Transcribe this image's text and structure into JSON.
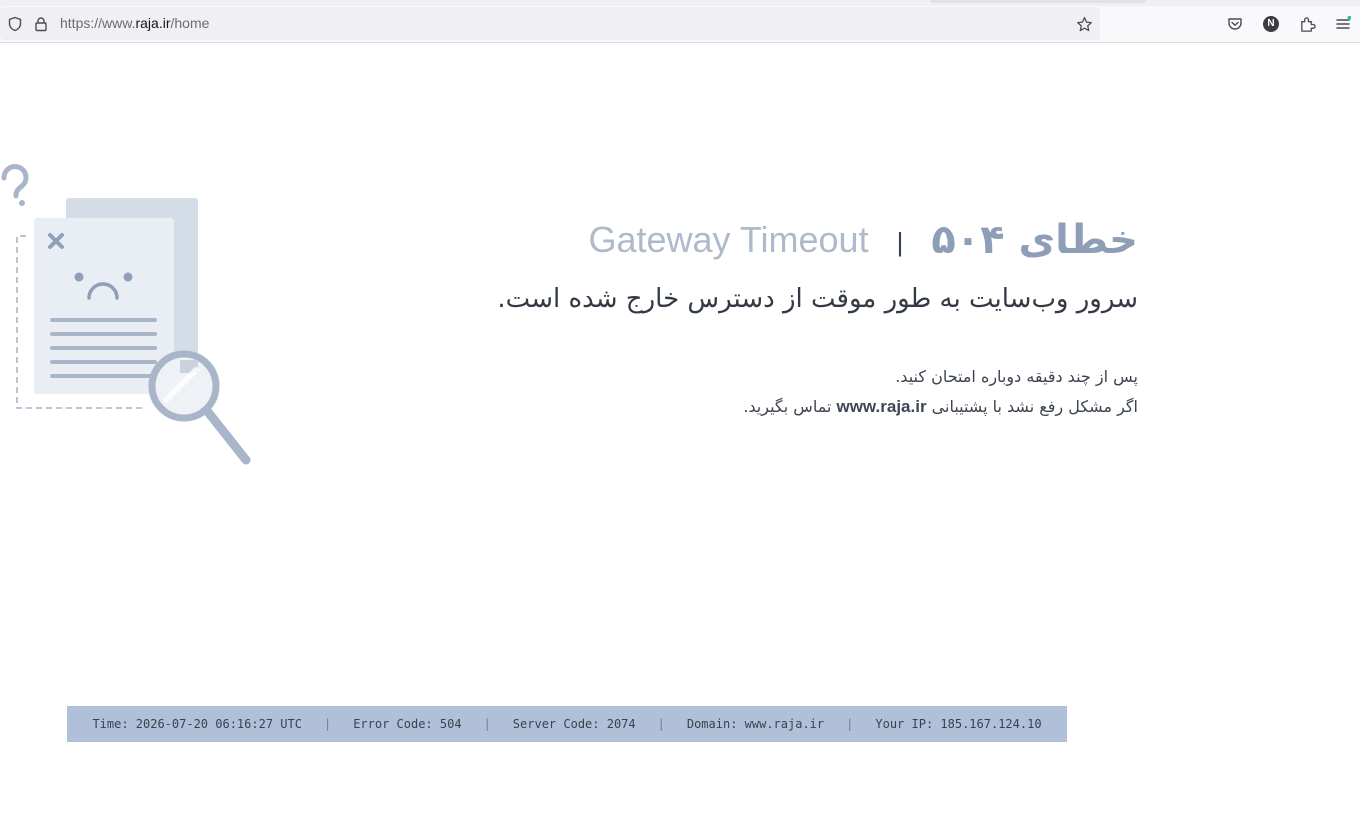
{
  "browser": {
    "url_prefix": "https://www.",
    "url_host": "raja.ir",
    "url_path": "/home",
    "profile_initial": "N"
  },
  "page": {
    "title_en": "Gateway Timeout",
    "title_separator": "|",
    "title_fa": "خطای ۵۰۴",
    "subtitle": "سرور وب‌سایت به طور موقت از دسترس خارج شده است.",
    "line1": "پس از چند دقیقه دوباره امتحان کنید.",
    "line2_before": "اگر مشکل رفع نشد با پشتیبانی",
    "line2_domain": "www.raja.ir",
    "line2_after": "تماس بگیرید."
  },
  "info": {
    "time": "Time: 2026-07-20 06:16:27 UTC",
    "error_code": "Error Code: 504",
    "server_code": "Server Code: 2074",
    "domain": "Domain: www.raja.ir",
    "ip": "Your IP: 185.167.124.10",
    "separator": "|"
  },
  "colors": {
    "accent": "#8e9eb6",
    "infobar_bg": "#b0c0d8",
    "text_dark": "#333a46"
  },
  "icons": {
    "shield": "shield-icon",
    "lock": "lock-icon",
    "star": "star-icon",
    "pocket": "pocket-icon",
    "extensions": "extensions-icon",
    "menu": "menu-icon"
  }
}
